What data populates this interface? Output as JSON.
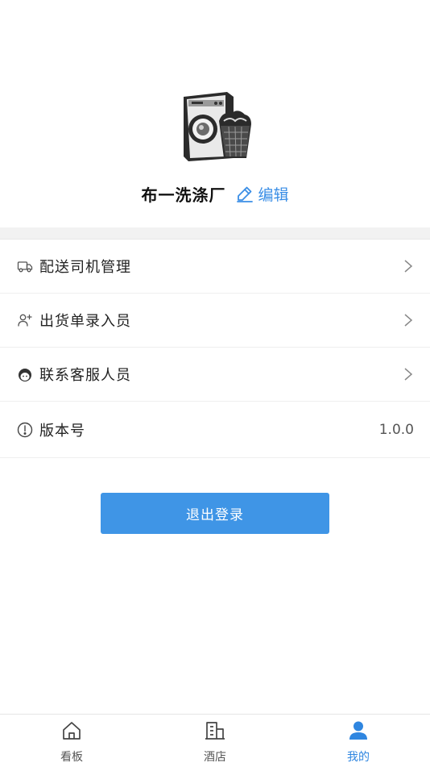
{
  "profile": {
    "shop_name": "布一洗涤厂",
    "edit_label": "编辑",
    "logo_icon": "washing-machine-laundry-basket-icon"
  },
  "menu": {
    "items": [
      {
        "icon": "truck-icon",
        "label": "配送司机管理"
      },
      {
        "icon": "add-user-icon",
        "label": "出货单录入员"
      },
      {
        "icon": "customer-service-icon",
        "label": "联系客服人员"
      }
    ],
    "version": {
      "icon": "info-circle-icon",
      "label": "版本号",
      "value": "1.0.0"
    }
  },
  "logout_label": "退出登录",
  "tabbar": {
    "tabs": [
      {
        "icon": "home-icon",
        "label": "看板",
        "active": false
      },
      {
        "icon": "building-icon",
        "label": "酒店",
        "active": false
      },
      {
        "icon": "user-icon",
        "label": "我的",
        "active": true
      }
    ]
  },
  "colors": {
    "accent": "#3f95e6",
    "active_tab": "#2f86e0",
    "band": "#f2f2f2"
  }
}
